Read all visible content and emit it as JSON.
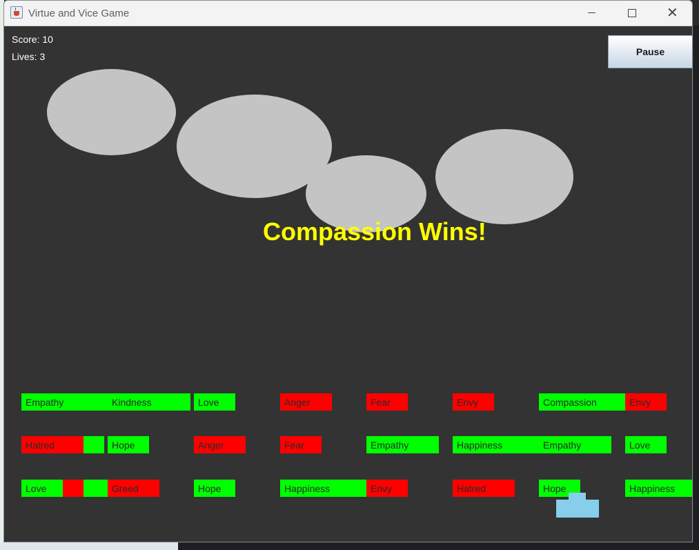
{
  "window": {
    "title": "Virtue and Vice Game",
    "controls": [
      "minimize",
      "maximize",
      "close"
    ],
    "close_glyph": "✕"
  },
  "hud": {
    "score_text": "Score: 10",
    "lives_text": "Lives: 3",
    "pause_label": "Pause"
  },
  "message": "Compassion Wins!",
  "colors": {
    "background": "#333333",
    "virtue": "#00ff00",
    "vice": "#ff0000",
    "cloud": "#c4c4c4",
    "message": "#ffff00",
    "player": "#87ceeb"
  },
  "clouds": 4,
  "bricks": {
    "row1": [
      {
        "label": "Empathy",
        "kind": "virtue"
      },
      {
        "label": "Kindness",
        "kind": "virtue"
      },
      {
        "label": "Love",
        "kind": "virtue"
      },
      {
        "label": "Anger",
        "kind": "vice"
      },
      {
        "label": "Fear",
        "kind": "vice"
      },
      {
        "label": "Envy",
        "kind": "vice"
      },
      {
        "label": "Compassion",
        "kind": "virtue"
      },
      {
        "label": "Envy",
        "kind": "vice"
      }
    ],
    "row2": [
      {
        "label": "Hatred",
        "kind": "vice"
      },
      {
        "label": "",
        "kind": "virtue"
      },
      {
        "label": "Hope",
        "kind": "virtue"
      },
      {
        "label": "Anger",
        "kind": "vice"
      },
      {
        "label": "Fear",
        "kind": "vice"
      },
      {
        "label": "Empathy",
        "kind": "virtue"
      },
      {
        "label": "Happiness",
        "kind": "virtue"
      },
      {
        "label": "Empathy",
        "kind": "virtue"
      },
      {
        "label": "Love",
        "kind": "virtue"
      }
    ],
    "row3": [
      {
        "label": "Love",
        "kind": "virtue"
      },
      {
        "label": "",
        "kind": "vice"
      },
      {
        "label": "",
        "kind": "virtue"
      },
      {
        "label": "Greed",
        "kind": "vice"
      },
      {
        "label": "Hope",
        "kind": "virtue"
      },
      {
        "label": "Happiness",
        "kind": "virtue"
      },
      {
        "label": "Envy",
        "kind": "vice"
      },
      {
        "label": "Hatred",
        "kind": "vice"
      },
      {
        "label": "Hope",
        "kind": "virtue"
      },
      {
        "label": "Happiness",
        "kind": "virtue"
      }
    ]
  }
}
